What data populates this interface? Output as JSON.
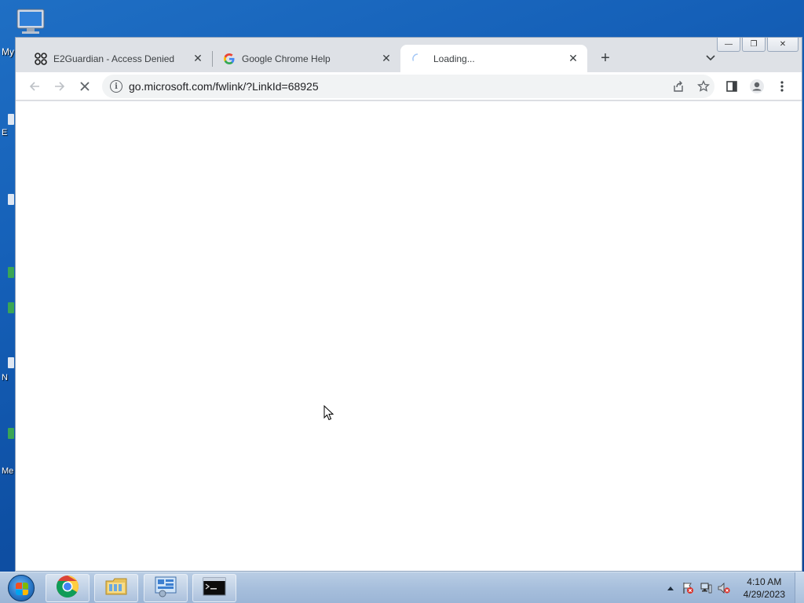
{
  "desktop": {
    "labels": [
      "My",
      "E",
      "N",
      "Me"
    ]
  },
  "browser": {
    "tabs": [
      {
        "title": "E2Guardian - Access Denied",
        "icon": "e2guardian-icon",
        "active": false
      },
      {
        "title": "Google Chrome Help",
        "icon": "google-g-icon",
        "active": false
      },
      {
        "title": "Loading...",
        "icon": "loading-spinner-icon",
        "active": true
      }
    ],
    "tab_close_glyph": "✕",
    "new_tab_glyph": "+",
    "url": "go.microsoft.com/fwlink/?LinkId=68925",
    "window_controls": {
      "minimize": "—",
      "restore": "❐",
      "close": "✕"
    }
  },
  "taskbar": {
    "apps": [
      "chrome-icon",
      "file-explorer-icon",
      "control-panel-icon",
      "command-prompt-icon"
    ],
    "clock_time": "4:10 AM",
    "clock_date": "4/29/2023"
  },
  "colors": {
    "desktop_blue": "#1560b8",
    "tab_strip": "#dee1e6",
    "omnibox": "#f1f3f4",
    "taskbar": "#a7bfdc"
  }
}
